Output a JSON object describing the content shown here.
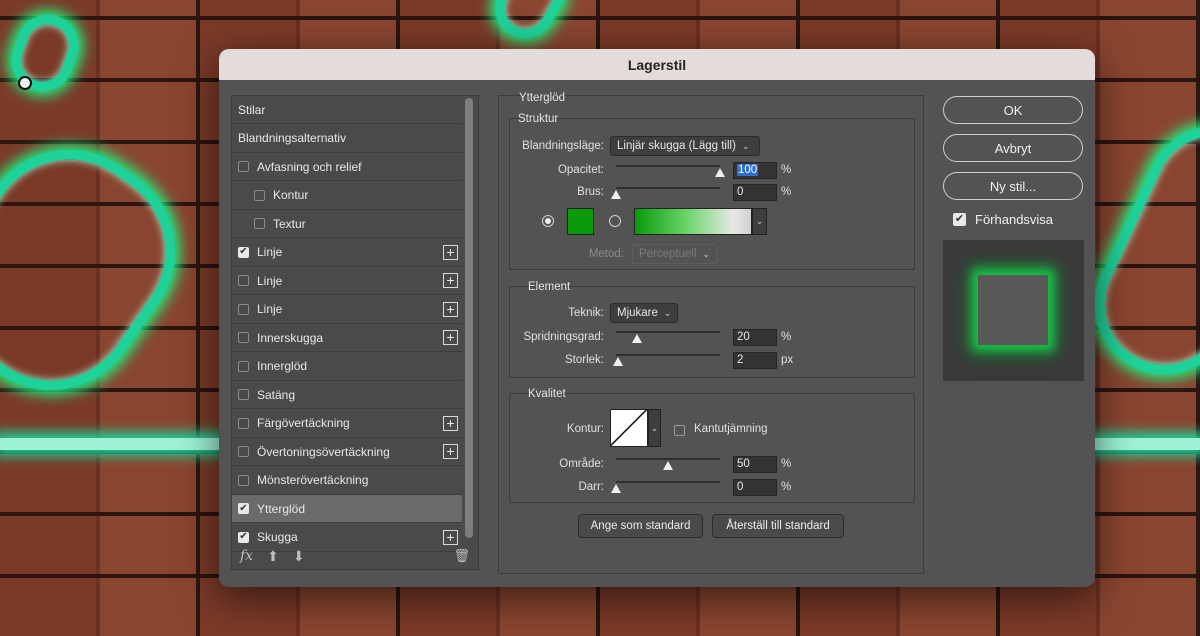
{
  "dialog": {
    "title": "Lagerstil"
  },
  "style_list": {
    "items": [
      {
        "label": "Stilar",
        "checkbox": false,
        "checked": false,
        "plus": false,
        "indent": 0,
        "active": false
      },
      {
        "label": "Blandningsalternativ",
        "checkbox": false,
        "checked": false,
        "plus": false,
        "indent": 0,
        "active": false
      },
      {
        "label": "Avfasning och relief",
        "checkbox": true,
        "checked": false,
        "plus": false,
        "indent": 0,
        "active": false
      },
      {
        "label": "Kontur",
        "checkbox": true,
        "checked": false,
        "plus": false,
        "indent": 1,
        "active": false
      },
      {
        "label": "Textur",
        "checkbox": true,
        "checked": false,
        "plus": false,
        "indent": 1,
        "active": false
      },
      {
        "label": "Linje",
        "checkbox": true,
        "checked": true,
        "plus": true,
        "indent": 0,
        "active": false
      },
      {
        "label": "Linje",
        "checkbox": true,
        "checked": false,
        "plus": true,
        "indent": 0,
        "active": false
      },
      {
        "label": "Linje",
        "checkbox": true,
        "checked": false,
        "plus": true,
        "indent": 0,
        "active": false
      },
      {
        "label": "Innerskugga",
        "checkbox": true,
        "checked": false,
        "plus": true,
        "indent": 0,
        "active": false
      },
      {
        "label": "Innerglöd",
        "checkbox": true,
        "checked": false,
        "plus": false,
        "indent": 0,
        "active": false
      },
      {
        "label": "Satäng",
        "checkbox": true,
        "checked": false,
        "plus": false,
        "indent": 0,
        "active": false
      },
      {
        "label": "Färgövertäckning",
        "checkbox": true,
        "checked": false,
        "plus": true,
        "indent": 0,
        "active": false
      },
      {
        "label": "Övertoningsövertäckning",
        "checkbox": true,
        "checked": false,
        "plus": true,
        "indent": 0,
        "active": false
      },
      {
        "label": "Mönsterövertäckning",
        "checkbox": true,
        "checked": false,
        "plus": false,
        "indent": 0,
        "active": false
      },
      {
        "label": "Ytterglöd",
        "checkbox": true,
        "checked": true,
        "plus": false,
        "indent": 0,
        "active": true
      },
      {
        "label": "Skugga",
        "checkbox": true,
        "checked": true,
        "plus": true,
        "indent": 0,
        "active": false
      }
    ],
    "footer": {
      "fx_label": "fx"
    }
  },
  "outer_glow": {
    "section_title": "Ytterglöd",
    "structure": {
      "title": "Struktur",
      "blend_mode_label": "Blandningsläge:",
      "blend_mode_value": "Linjär skugga (Lägg till)",
      "opacity_label": "Opacitet:",
      "opacity_value": "100",
      "opacity_level": 1.0,
      "opacity_unit": "%",
      "noise_label": "Brus:",
      "noise_value": "0",
      "noise_level": 0.0,
      "noise_unit": "%",
      "color": "#0a9a0a",
      "method_label": "Metod:",
      "method_value": "Perceptuell"
    },
    "element": {
      "title": "Element",
      "technique_label": "Teknik:",
      "technique_value": "Mjukare",
      "spread_label": "Spridningsgrad:",
      "spread_value": "20",
      "spread_level": 0.2,
      "spread_unit": "%",
      "size_label": "Storlek:",
      "size_value": "2",
      "size_level": 0.02,
      "size_unit": "px"
    },
    "quality": {
      "title": "Kvalitet",
      "contour_label": "Kontur:",
      "antialias_label": "Kantutjämning",
      "range_label": "Område:",
      "range_value": "50",
      "range_level": 0.5,
      "range_unit": "%",
      "jitter_label": "Darr:",
      "jitter_value": "0",
      "jitter_level": 0.0,
      "jitter_unit": "%"
    },
    "buttons": {
      "make_default": "Ange som standard",
      "reset_default": "Återställ till standard"
    }
  },
  "actions": {
    "ok": "OK",
    "cancel": "Avbryt",
    "new_style": "Ny stil...",
    "preview_label": "Förhandsvisa",
    "preview_checked": true
  },
  "colors": {
    "glow": "#17c54a",
    "neon": "#1fd29a",
    "dialog_bg": "#535353",
    "title_bg": "#e4dcda"
  }
}
